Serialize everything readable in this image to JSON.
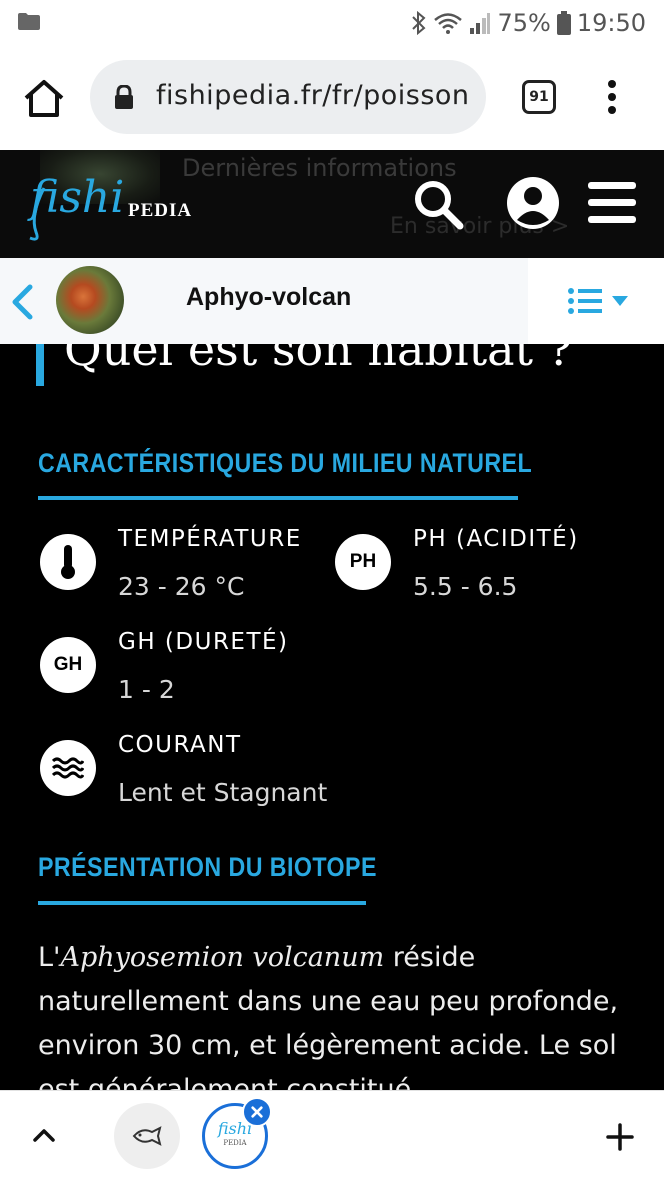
{
  "status_bar": {
    "battery": "75%",
    "time": "19:50"
  },
  "browser": {
    "url": "fishipedia.fr/fr/poisson",
    "tab_count": "91"
  },
  "site_header": {
    "logo_fishi": "fishi",
    "logo_pedia": "PEDIA",
    "behind_text_1": "Dernières informations",
    "behind_text_2": "En savoir plus >"
  },
  "species_bar": {
    "name": "Aphyo-volcan"
  },
  "main": {
    "heading": "Quel est son habitat ?",
    "section1_title": "CARACTÉRISTIQUES DU MILIEU NATUREL",
    "params": [
      {
        "label": "TEMPÉRATURE",
        "value": "23 - 26 °C",
        "icon": "thermometer-icon"
      },
      {
        "label": "PH (ACIDITÉ)",
        "value": "5.5 - 6.5",
        "icon": "ph-icon",
        "icon_text": "PH"
      },
      {
        "label": "GH (DURETÉ)",
        "value": "1 - 2",
        "icon": "gh-icon",
        "icon_text": "GH"
      },
      {
        "label": "COURANT",
        "value": "Lent et Stagnant",
        "icon": "water-current-icon"
      }
    ],
    "section2_title": "PRÉSENTATION DU BIOTOPE",
    "body": {
      "prefix": "L'",
      "scientific_name": "Aphyosemion volcanum",
      "rest": " réside naturellement dans une eau peu profonde, environ 30 cm, et légèrement acide. Le sol est généralement constitué"
    }
  },
  "bottom_bar": {
    "tab_mini_logo": "fishi",
    "tab_mini_sub": "PEDIA"
  },
  "colors": {
    "accent": "#29a8e0",
    "background": "#000000",
    "tab_highlight": "#1a6fd8"
  }
}
